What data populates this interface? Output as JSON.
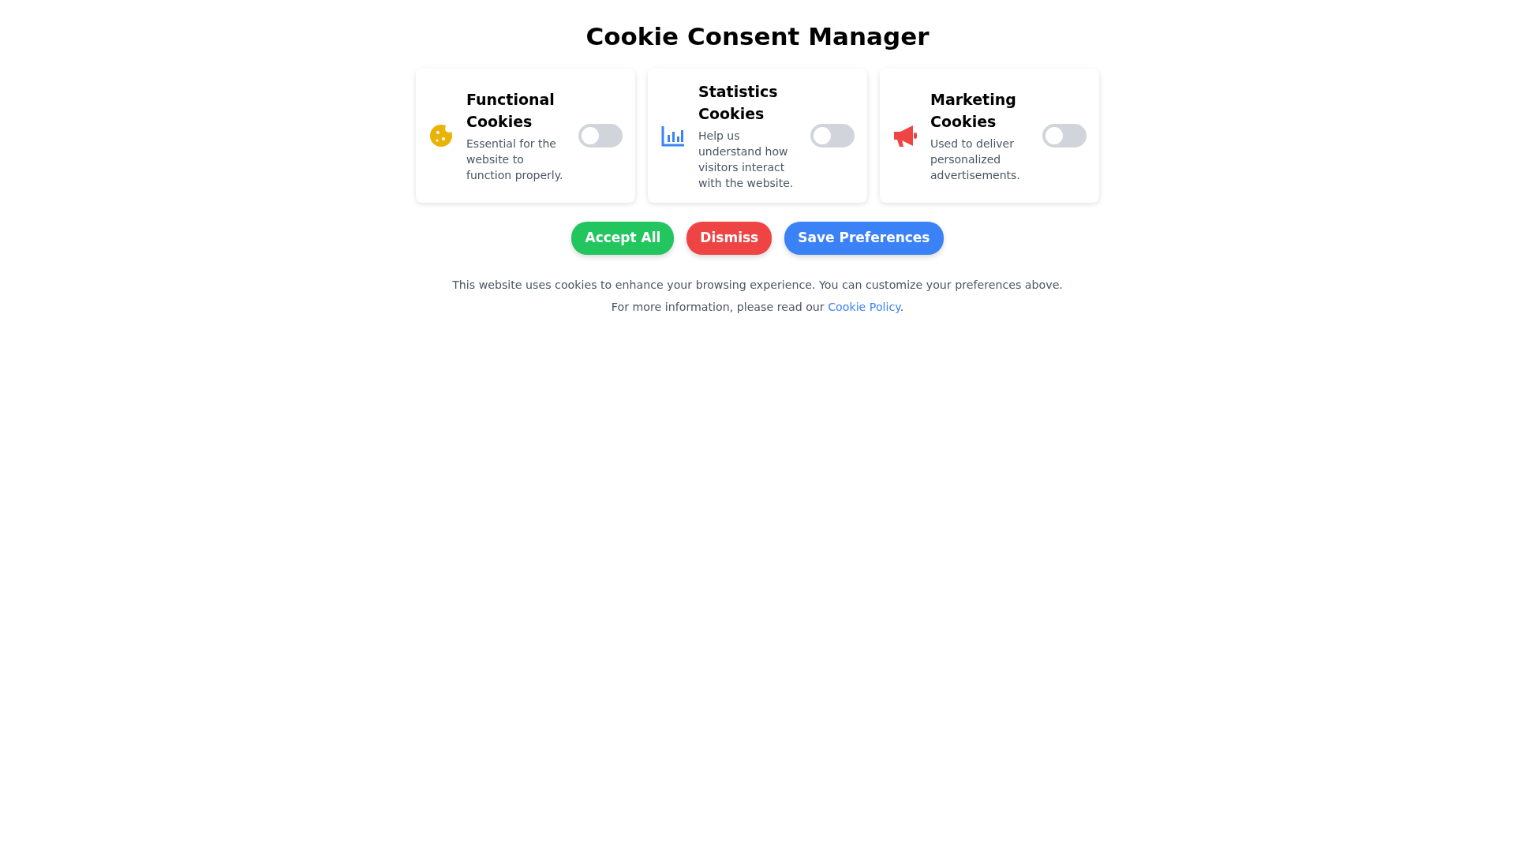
{
  "title": "Cookie Consent Manager",
  "categories": [
    {
      "kind": "cookie",
      "name": "Functional Cookies",
      "description": "Essential for the website to function properly.",
      "on": false
    },
    {
      "kind": "chart",
      "name": "Statistics Cookies",
      "description": "Help us understand how visitors interact with the website.",
      "on": false
    },
    {
      "kind": "megaphone",
      "name": "Marketing Cookies",
      "description": "Used to deliver personalized advertisements.",
      "on": false
    }
  ],
  "buttons": [
    {
      "label": "Accept All",
      "kind": "accept"
    },
    {
      "label": "Dismiss",
      "kind": "dismiss"
    },
    {
      "label": "Save Preferences",
      "kind": "save"
    }
  ],
  "notice": "This website uses cookies to enhance your browsing experience. You can customize your preferences above.",
  "more_info": {
    "before": "For more information, please read our ",
    "link": "Cookie Policy",
    "after": "."
  }
}
